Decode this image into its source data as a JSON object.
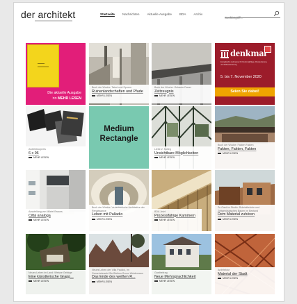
{
  "header": {
    "logo": "der architekt",
    "nav": [
      "Startseite",
      "Nachrichten",
      "Aktuelle Ausgabe",
      "BDA",
      "Archiv"
    ],
    "search_placeholder": "Suchbegriff..."
  },
  "tiles": {
    "cover": {
      "issue": "Die aktuelle Ausgabe",
      "cta": ">>  MEHR LESEN"
    },
    "t2": {
      "kicker": "Buch der Woche: Tatort und Spuren",
      "title": "Ruinenlandschaften und Pfade",
      "more": "MEHR LESEN"
    },
    "t3": {
      "kicker": "Buch der Woche: Gebaute Dauer",
      "title": "Zeitzeugnis",
      "more": "MEHR LESEN"
    },
    "denkmal": {
      "brand": "denkmal",
      "subtitle": "Europäische Leitmesse für Denkmalpflege, Restaurierung und Altbausanierung",
      "date": "5. bis 7. November 2020",
      "cta": "Seien Sie dabei!"
    },
    "t5": {
      "kicker": "Architekturpreis",
      "title": "6 x 96",
      "more": "MEHR LESEN"
    },
    "ad": {
      "label": "Medium Rectangle"
    },
    "t7": {
      "kicker": "Liebe 2. Kolleg",
      "title": "Unsichtbare Möglichkeiten",
      "more": "MEHR LESEN"
    },
    "t8": {
      "kicker": "Buch der Woche: Fakten Fakten",
      "title": "Fakten, Fakten, Fakten",
      "more": "MEHR LESEN"
    },
    "t9": {
      "kicker": "Ausstellung von Mörtel Brauns",
      "title": "Città analoga",
      "more": "MEHR LESEN"
    },
    "t10": {
      "kicker": "Buch der Woche: Venezianische Architektur der Renaissance",
      "title": "Leben mit Palladio",
      "more": "MEHR LESEN"
    },
    "t11": {
      "kicker": "BDA Jetzt",
      "title": "Prozessfähige Kammern",
      "more": "MEHR LESEN"
    },
    "t12": {
      "kicker": "Zu Gast im Studio: Ruhrtalbrücke und Zeitgenössisches Bauen im Bestand",
      "title": "Dem Material zuhören",
      "more": "MEHR LESEN"
    },
    "t13": {
      "kicker": "Neues Leben im Land: Weisse Gebirge",
      "title": "Eine künstlerische Grapp...",
      "more": "MEHR LESEN"
    },
    "t14": {
      "kicker": "Neues Leben der Villa Paulick, Im Gemeindewald Sie Bleiben Bruno Weidemann",
      "title": "Das Ende des weißen R...",
      "more": "MEHR LESEN"
    },
    "t15": {
      "kicker": "Gastbeitrag",
      "title": "Neue Mehrsprachlichkeit",
      "more": "MEHR LESEN"
    },
    "t16": {
      "kicker": "Architektur",
      "title": "Material der Stadt",
      "more": "MEHR LESEN"
    }
  },
  "colors": {
    "cover_magenta": "#e21e79",
    "cover_yellow": "#f3d51c",
    "denkmal_red": "#9c1c2a",
    "denkmal_orange": "#f0a400",
    "ad_green": "#79c9b0"
  }
}
